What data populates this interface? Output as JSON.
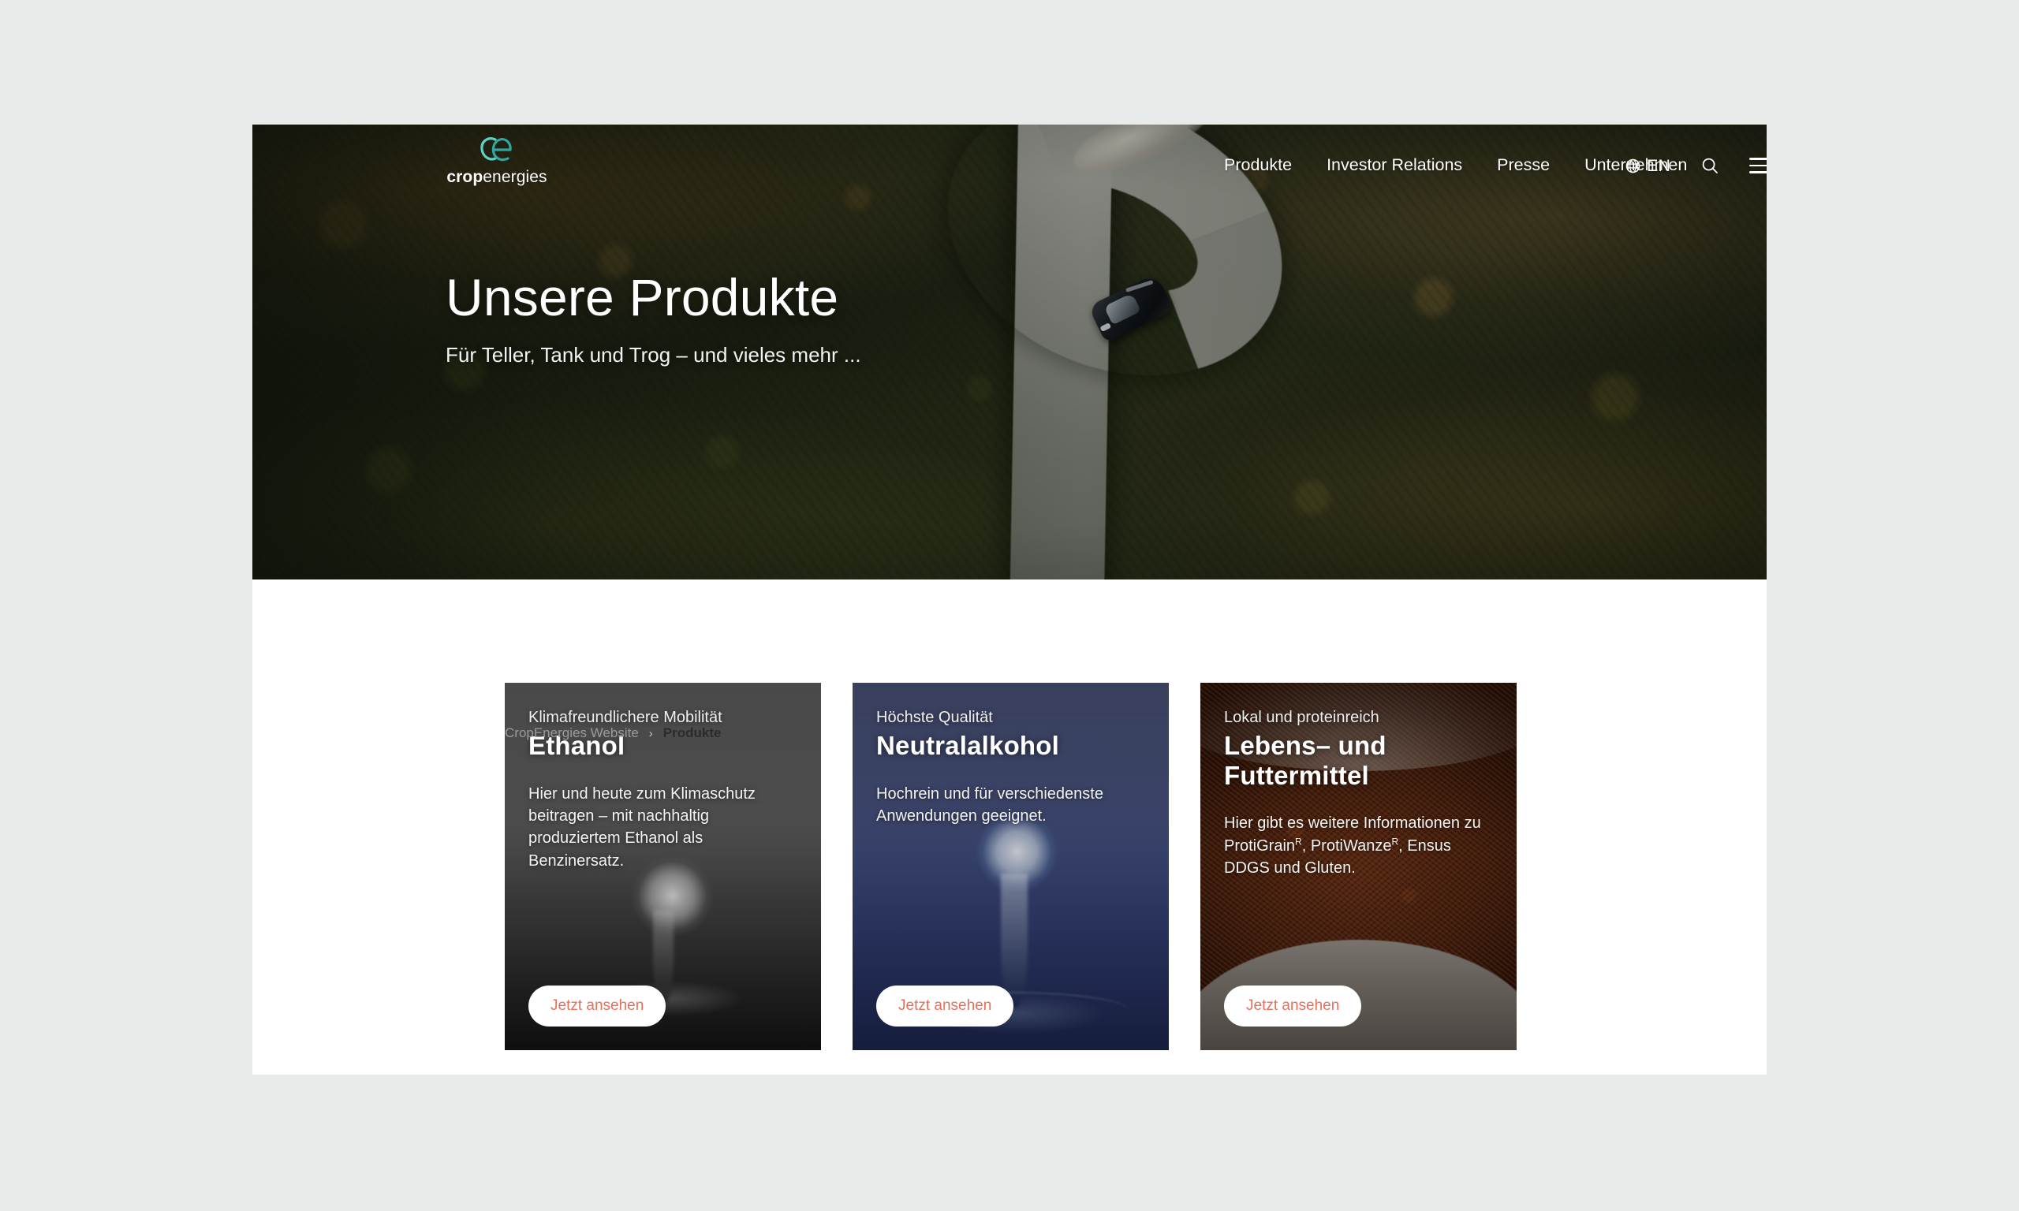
{
  "site": {
    "background_color": "#e7ebe9",
    "accent_color": "#e4705a",
    "brand_teal": "#3fb6b1"
  },
  "header": {
    "logo": {
      "mark": "ce-monogram-icon",
      "word_bold": "crop",
      "word_light": "energies"
    },
    "nav": [
      {
        "label": "Produkte"
      },
      {
        "label": "Investor Relations"
      },
      {
        "label": "Presse"
      },
      {
        "label": "Unternehmen"
      }
    ],
    "language": {
      "icon": "globe-icon",
      "code": "EN"
    },
    "search_icon": "search-icon",
    "menu_icon": "hamburger-menu-icon"
  },
  "hero": {
    "title": "Unsere Produkte",
    "subtitle": "Für Teller, Tank und Trog – und vieles mehr ..."
  },
  "breadcrumb": {
    "root": "CropEnergies Website",
    "separator": "›",
    "current": "Produkte"
  },
  "cards": [
    {
      "eyebrow": "Klimafreundlichere Mobilität",
      "title": "Ethanol",
      "description": "Hier und heute zum Klimaschutz beitragen  – mit nachhaltig produziertem Ethanol als Benzinersatz.",
      "cta": "Jetzt ansehen",
      "image": "glass-sphere-grayscale"
    },
    {
      "eyebrow": "Höchste Qualität",
      "title": "Neutralalkohol",
      "description": "Hochrein und für verschiedenste Anwendungen geeignet.",
      "cta": "Jetzt ansehen",
      "image": "blue-water-drop"
    },
    {
      "eyebrow": "Lokal und proteinreich",
      "title": "Lebens– und Futtermittel",
      "description_parts": [
        "Hier gibt es weitere Informationen zu ProtiGrain",
        "R",
        ", ProtiWanze",
        "R",
        ", Ensus DDGS und Gluten."
      ],
      "cta": "Jetzt ansehen",
      "image": "brown-grain-bowl"
    }
  ]
}
